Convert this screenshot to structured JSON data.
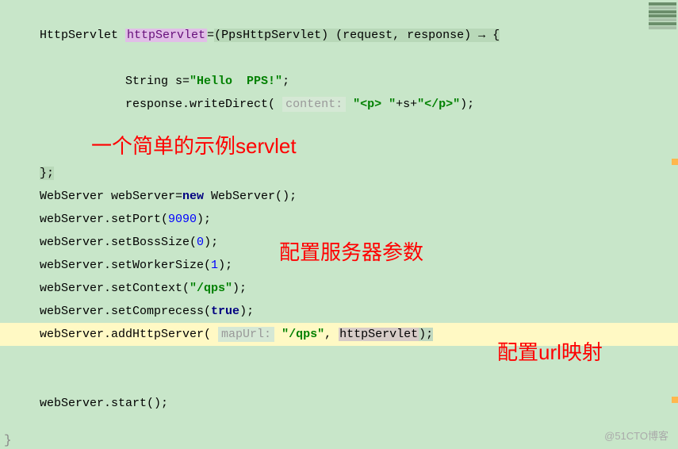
{
  "code": {
    "l1_type": "HttpServlet ",
    "l1_var": "httpServlet",
    "l1_eq": "=",
    "l1_cast": "(PpsHttpServlet) (request, response) → {",
    "l2": "            String s=",
    "l2_str": "\"Hello  PPS!\"",
    "l2_end": ";",
    "l3": "            response.writeDirect( ",
    "l3_hint": "content:",
    "l3_str1": " \"<p> \"",
    "l3_mid": "+s+",
    "l3_str2": "\"</p>\"",
    "l3_end": ");",
    "l4": "};",
    "l5": "WebServer webServer=",
    "l5_new": "new",
    "l5_end": " WebServer();",
    "l6": "webServer.setPort(",
    "l6_num": "9090",
    "l6_end": ");",
    "l7": "webServer.setBossSize(",
    "l7_num": "0",
    "l7_end": ");",
    "l8": "webServer.setWorkerSize(",
    "l8_num": "1",
    "l8_end": ");",
    "l9": "webServer.setContext(",
    "l9_str": "\"/qps\"",
    "l9_end": ");",
    "l10": "webServer.setComprecess(",
    "l10_kw": "true",
    "l10_end": ");",
    "l11": "webServer.addHttpServer( ",
    "l11_hint": "mapUrl:",
    "l11_str": " \"/qps\"",
    "l11_mid": ", ",
    "l11_var": "httpServlet",
    "l11_end": ");",
    "l12": "webServer.start();"
  },
  "annotations": {
    "a1": "一个简单的示例servlet",
    "a2": "配置服务器参数",
    "a3": "配置url映射"
  },
  "watermark": "@51CTO博客"
}
